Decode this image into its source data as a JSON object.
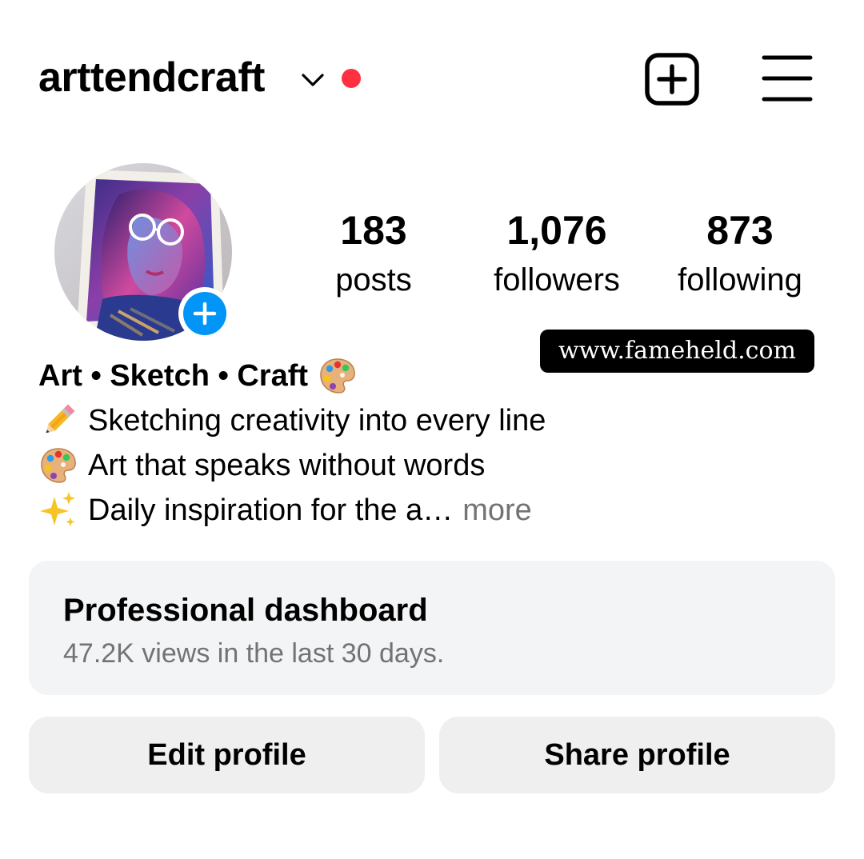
{
  "header": {
    "username": "arttendcraft",
    "icons": {
      "switch_account": "chevron-down-icon",
      "notification": "red-dot",
      "create": "plus-square-icon",
      "menu": "hamburger-menu-icon"
    },
    "notification_color": "#ff3040"
  },
  "profile": {
    "avatar": "profile-avatar",
    "add_story_icon": "plus-icon",
    "add_story_color": "#0095f6"
  },
  "stats": [
    {
      "value": "183",
      "label": "posts"
    },
    {
      "value": "1,076",
      "label": "followers"
    },
    {
      "value": "873",
      "label": "following"
    }
  ],
  "watermark": "www.fameheld.com",
  "bio": {
    "title": "Art • Sketch • Craft",
    "title_emoji": "palette-emoji",
    "lines": [
      {
        "emoji": "pencil-emoji",
        "text": "Sketching creativity into every line"
      },
      {
        "emoji": "palette-emoji",
        "text": "Art that speaks without words"
      },
      {
        "emoji": "sparkles-emoji",
        "text": "Daily inspiration for the a…"
      }
    ],
    "more": "more"
  },
  "dashboard": {
    "title": "Professional dashboard",
    "subtitle": "47.2K views in the last 30 days."
  },
  "buttons": {
    "edit": "Edit profile",
    "share": "Share profile"
  },
  "colors": {
    "dashboard_bg": "#f3f4f6",
    "button_bg": "#efefef",
    "secondary_text": "#737373"
  }
}
